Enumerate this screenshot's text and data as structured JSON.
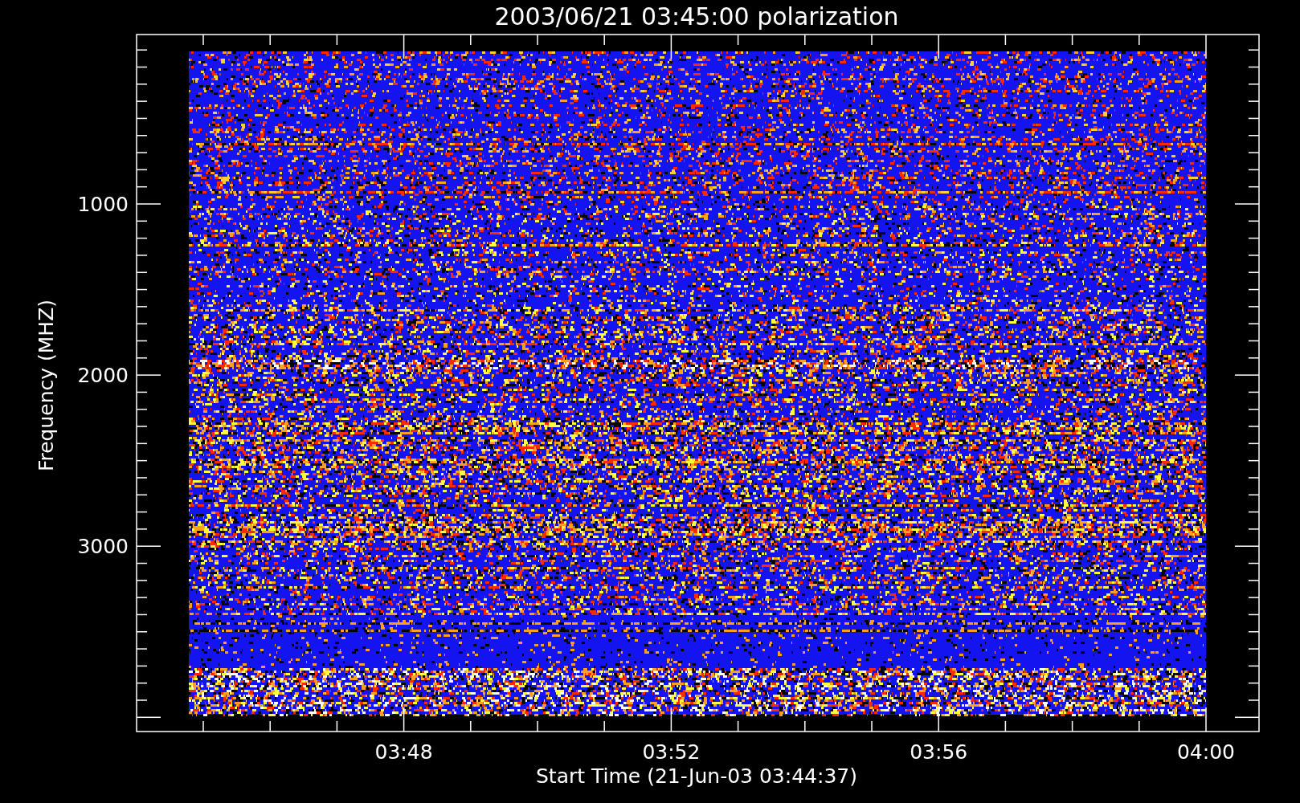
{
  "title": "2003/06/21 03:45:00 polarization",
  "y_axis": {
    "label": "Frequency (MHZ)",
    "ticks": [
      "1000",
      "2000",
      "3000"
    ]
  },
  "x_axis": {
    "label": "Start Time (21-Jun-03 03:44:37)",
    "ticks": [
      "03:48",
      "03:52",
      "03:56",
      "04:00"
    ]
  }
}
